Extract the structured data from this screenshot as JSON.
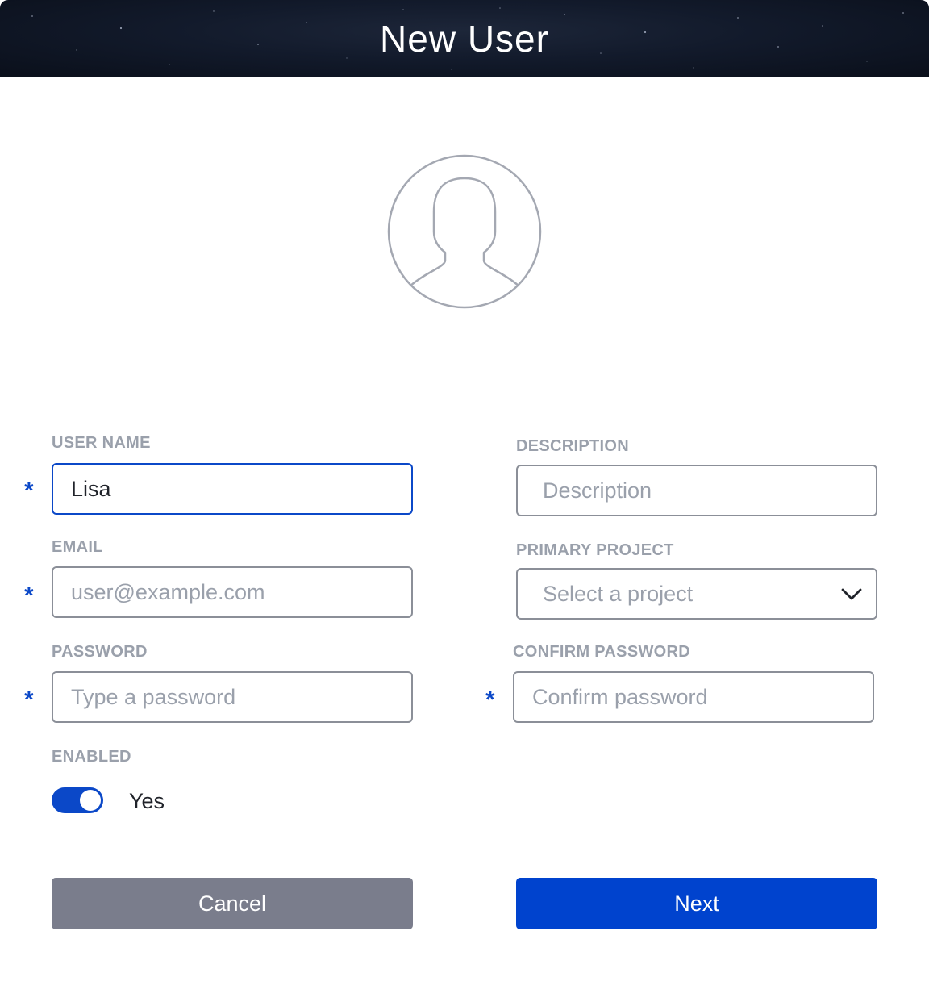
{
  "dialog": {
    "title": "New User"
  },
  "avatar": {
    "icon": "user-avatar-icon"
  },
  "form": {
    "required_marker": "*",
    "user_name": {
      "label": "USER NAME",
      "value": "Lisa",
      "required": true
    },
    "email": {
      "label": "EMAIL",
      "placeholder": "user@example.com",
      "value": "",
      "required": true
    },
    "password": {
      "label": "PASSWORD",
      "placeholder": "Type a password",
      "value": "",
      "required": true
    },
    "description": {
      "label": "DESCRIPTION",
      "placeholder": "Description",
      "value": "",
      "required": false
    },
    "primary_project": {
      "label": "PRIMARY PROJECT",
      "placeholder": "Select a project",
      "required": false,
      "icon": "chevron-down-icon"
    },
    "confirm_password": {
      "label": "CONFIRM PASSWORD",
      "placeholder": "Confirm password",
      "value": "",
      "required": true
    },
    "enabled": {
      "label": "ENABLED",
      "on": true,
      "state_text": "Yes"
    }
  },
  "actions": {
    "cancel_label": "Cancel",
    "next_label": "Next"
  },
  "colors": {
    "accent": "#0043ce",
    "cancel": "#7a7d8c",
    "label": "#9aa0ab",
    "border": "#8b8f98"
  }
}
